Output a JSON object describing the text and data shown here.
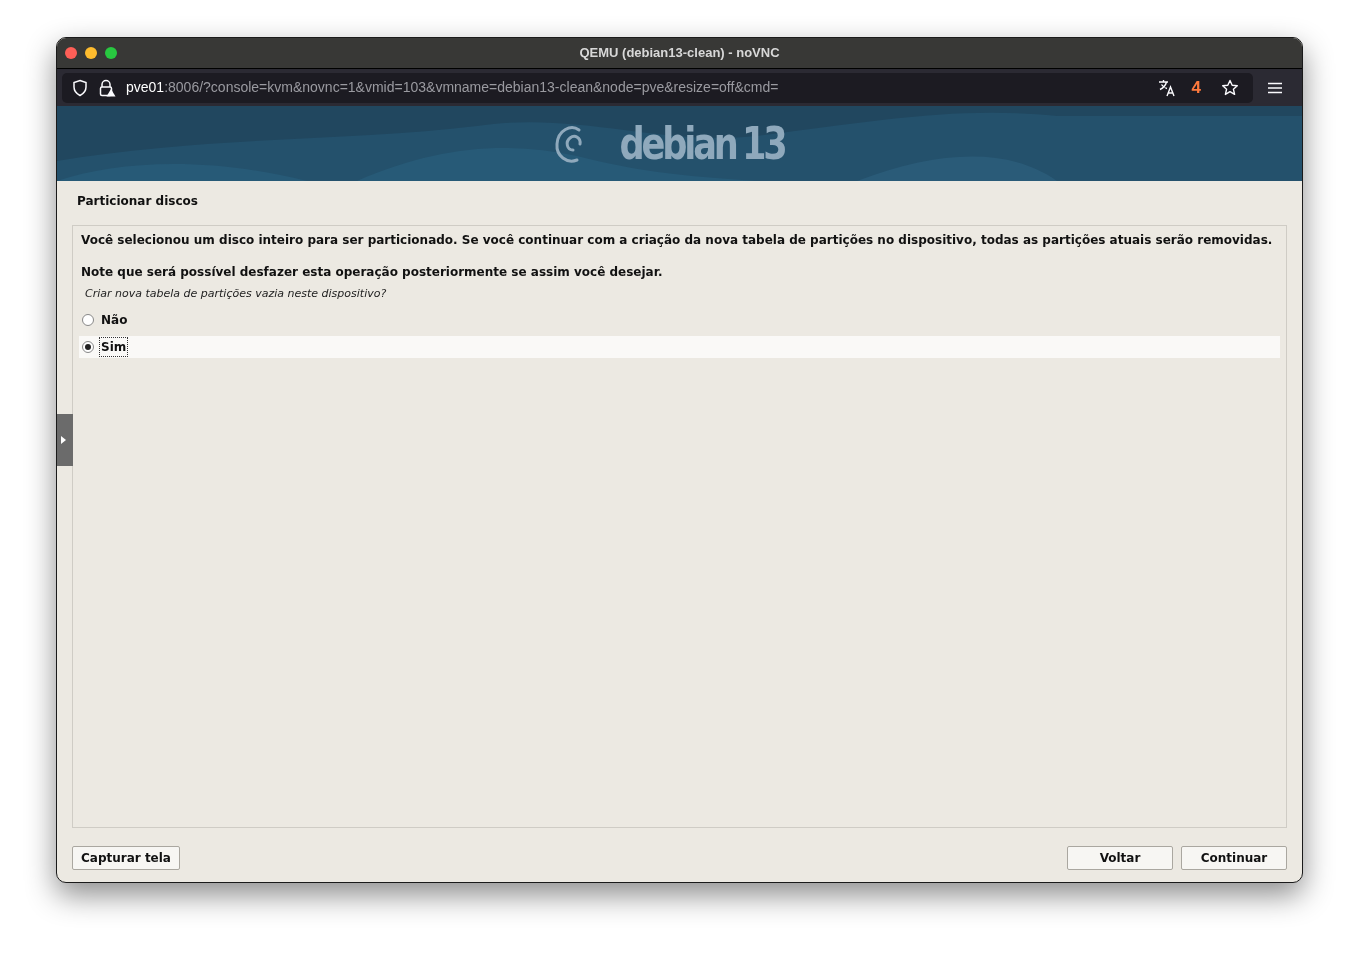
{
  "window": {
    "title": "QEMU (debian13-clean) - noVNC"
  },
  "address_bar": {
    "host": "pve01",
    "rest": ":8006/?console=kvm&novnc=1&vmid=103&vmname=debian13-clean&node=pve&resize=off&cmd=",
    "badge": "4"
  },
  "banner": {
    "logo_word": "debian",
    "logo_version": "13"
  },
  "installer": {
    "title": "Particionar discos",
    "paragraphs": [
      "Você selecionou um disco inteiro para ser particionado. Se você continuar com a criação da nova tabela de partições no dispositivo, todas as partições atuais serão removidas.",
      "Note que será possível desfazer esta operação posteriormente se assim você desejar."
    ],
    "question": "Criar nova tabela de partições vazia neste dispositivo?",
    "options": [
      {
        "label": "Não",
        "selected": false
      },
      {
        "label": "Sim",
        "selected": true
      }
    ],
    "left_buttons": [
      "Capturar tela"
    ],
    "right_buttons": [
      "Voltar",
      "Continuar"
    ]
  }
}
